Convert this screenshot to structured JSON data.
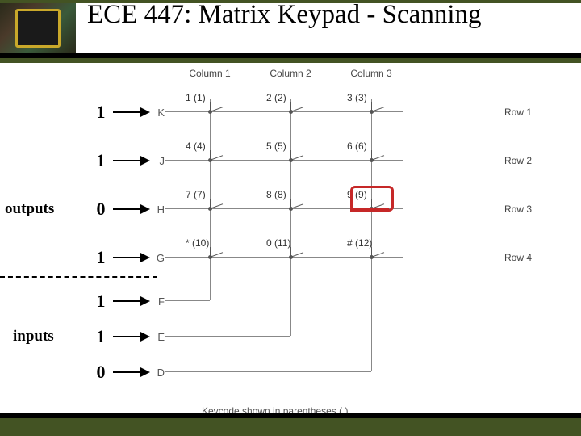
{
  "title": "ECE 447: Matrix Keypad - Scanning",
  "sections": {
    "outputs_label": "outputs",
    "inputs_label": "inputs"
  },
  "output_bits": [
    "1",
    "1",
    "0",
    "1"
  ],
  "input_bits": [
    "1",
    "1",
    "0"
  ],
  "columns": [
    "Column 1",
    "Column 2",
    "Column 3"
  ],
  "rows": [
    "Row 1",
    "Row 2",
    "Row 3",
    "Row 4"
  ],
  "drive_pins": [
    "K",
    "J",
    "H",
    "G",
    "F",
    "E",
    "D"
  ],
  "keys": [
    {
      "col": 0,
      "row": 0,
      "face": "1",
      "code": "(1)"
    },
    {
      "col": 1,
      "row": 0,
      "face": "2",
      "code": "(2)"
    },
    {
      "col": 2,
      "row": 0,
      "face": "3",
      "code": "(3)"
    },
    {
      "col": 0,
      "row": 1,
      "face": "4",
      "code": "(4)"
    },
    {
      "col": 1,
      "row": 1,
      "face": "5",
      "code": "(5)"
    },
    {
      "col": 2,
      "row": 1,
      "face": "6",
      "code": "(6)"
    },
    {
      "col": 0,
      "row": 2,
      "face": "7",
      "code": "(7)"
    },
    {
      "col": 1,
      "row": 2,
      "face": "8",
      "code": "(8)"
    },
    {
      "col": 2,
      "row": 2,
      "face": "9",
      "code": "(9)"
    },
    {
      "col": 0,
      "row": 3,
      "face": "*",
      "code": "(10)"
    },
    {
      "col": 1,
      "row": 3,
      "face": "0",
      "code": "(11)"
    },
    {
      "col": 2,
      "row": 3,
      "face": "#",
      "code": "(12)"
    }
  ],
  "footnote": "Keycode shown in parentheses ( )"
}
